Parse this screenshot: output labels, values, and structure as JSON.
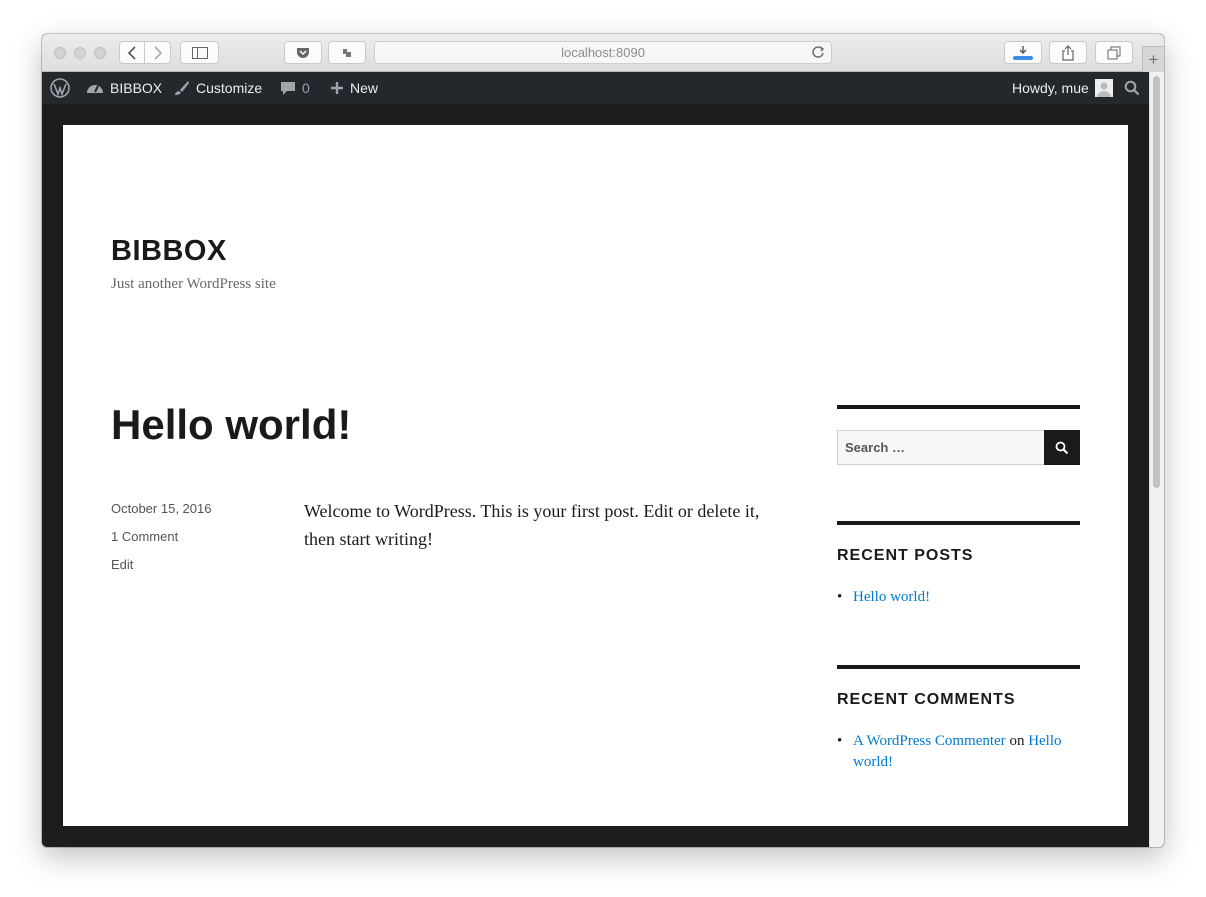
{
  "browser": {
    "url": "localhost:8090"
  },
  "admin_bar": {
    "site_name": "BIBBOX",
    "customize": "Customize",
    "comments_count": "0",
    "new_label": "New",
    "greeting": "Howdy, mue"
  },
  "site": {
    "title": "BIBBOX",
    "description": "Just another WordPress site"
  },
  "post": {
    "title": "Hello world!",
    "date": "October 15, 2016",
    "comments": "1 Comment",
    "edit": "Edit",
    "body": "Welcome to WordPress. This is your first post. Edit or delete it, then start writing!"
  },
  "sidebar": {
    "search_placeholder": "Search …",
    "recent_posts": {
      "title": "RECENT POSTS",
      "items": [
        "Hello world!"
      ]
    },
    "recent_comments": {
      "title": "RECENT COMMENTS",
      "author": "A WordPress Commenter",
      "connector": "on",
      "post": "Hello world!"
    }
  },
  "colors": {
    "link": "#007acc",
    "admin_bar": "#23282d",
    "frame": "#1d1d1d",
    "text": "#1a1a1a"
  }
}
